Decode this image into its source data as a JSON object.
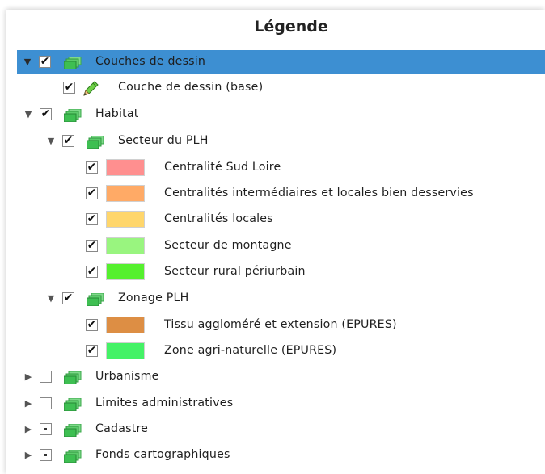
{
  "title": "Légende",
  "tree": {
    "couches_dessin": {
      "label": "Couches de dessin",
      "expanded": true,
      "checked": true
    },
    "couche_base": {
      "label": "Couche de dessin (base)",
      "checked": true
    },
    "habitat": {
      "label": "Habitat",
      "expanded": true,
      "checked": true
    },
    "secteur_plh": {
      "label": "Secteur du PLH",
      "expanded": true,
      "checked": true
    },
    "secteur_items": [
      {
        "label": "Centralité Sud Loire",
        "color": "#ff8f8f",
        "checked": true
      },
      {
        "label": "Centralités intermédiaires et locales bien desservies",
        "color": "#ffaa66",
        "checked": true
      },
      {
        "label": "Centralités locales",
        "color": "#ffd66b",
        "checked": true
      },
      {
        "label": "Secteur de montagne",
        "color": "#99f57f",
        "checked": true
      },
      {
        "label": "Secteur rural périurbain",
        "color": "#55f02e",
        "checked": true
      }
    ],
    "zonage_plh": {
      "label": "Zonage PLH",
      "expanded": true,
      "checked": true
    },
    "zonage_items": [
      {
        "label": "Tissu aggloméré et extension (EPURES)",
        "color": "#dd8e44",
        "checked": true
      },
      {
        "label": "Zone agri-naturelle (EPURES)",
        "color": "#44f266",
        "checked": true
      }
    ],
    "urbanisme": {
      "label": "Urbanisme",
      "expanded": false,
      "checked": false
    },
    "limites": {
      "label": "Limites administratives",
      "expanded": false,
      "checked": false
    },
    "cadastre": {
      "label": "Cadastre",
      "expanded": false,
      "checked": "partial"
    },
    "fonds": {
      "label": "Fonds cartographiques",
      "expanded": false,
      "checked": "partial"
    }
  },
  "colors": {
    "selection": "#3d8fd2",
    "folder_green": "#2fb84a"
  },
  "glyphs": {
    "check": "✔",
    "expanded": "▼",
    "collapsed": "▶"
  },
  "icons": [
    "expand-arrow-icon",
    "checkbox-icon",
    "layer-group-icon",
    "pencil-icon",
    "color-swatch"
  ]
}
